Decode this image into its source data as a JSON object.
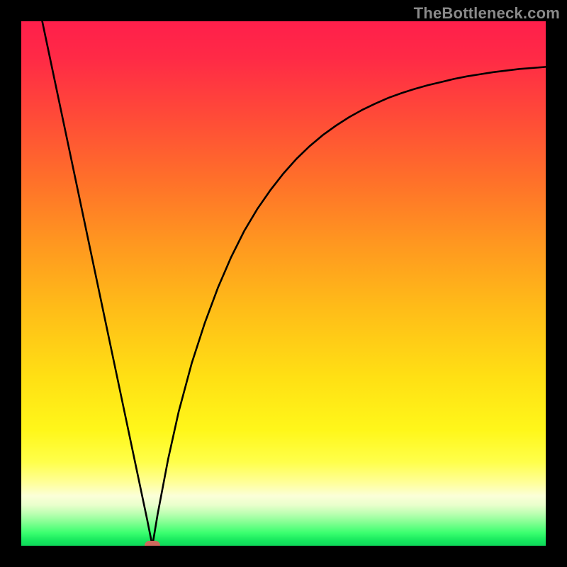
{
  "watermark": "TheBottleneck.com",
  "colors": {
    "frame": "#000000",
    "marker": "#cf6a5e",
    "gradient_stops": [
      {
        "offset": 0.0,
        "color": "#ff1f4b"
      },
      {
        "offset": 0.07,
        "color": "#ff2a46"
      },
      {
        "offset": 0.18,
        "color": "#ff4a38"
      },
      {
        "offset": 0.3,
        "color": "#ff6f2a"
      },
      {
        "offset": 0.42,
        "color": "#ff9620"
      },
      {
        "offset": 0.55,
        "color": "#ffbd18"
      },
      {
        "offset": 0.68,
        "color": "#ffe014"
      },
      {
        "offset": 0.78,
        "color": "#fff71a"
      },
      {
        "offset": 0.84,
        "color": "#ffff4a"
      },
      {
        "offset": 0.88,
        "color": "#ffff9a"
      },
      {
        "offset": 0.905,
        "color": "#fbffd8"
      },
      {
        "offset": 0.922,
        "color": "#eaffcc"
      },
      {
        "offset": 0.94,
        "color": "#b8ffb0"
      },
      {
        "offset": 0.958,
        "color": "#7bff8e"
      },
      {
        "offset": 0.975,
        "color": "#3cff70"
      },
      {
        "offset": 0.99,
        "color": "#16e85e"
      },
      {
        "offset": 1.0,
        "color": "#0fd85a"
      }
    ]
  },
  "chart_data": {
    "type": "line",
    "title": "",
    "xlabel": "",
    "ylabel": "",
    "xlim": [
      0,
      100
    ],
    "ylim": [
      0,
      100
    ],
    "optimum_x": 25,
    "marker": {
      "x": 25,
      "y": 0
    },
    "series": [
      {
        "name": "bottleneck-curve",
        "x": [
          4.0,
          6.0,
          8.0,
          10.0,
          12.0,
          14.0,
          16.0,
          18.0,
          20.0,
          22.0,
          24.0,
          25.0,
          26.0,
          28.0,
          30.0,
          32.5,
          35.0,
          37.5,
          40.0,
          42.5,
          45.0,
          47.5,
          50.0,
          52.5,
          55.0,
          57.5,
          60.0,
          62.5,
          65.0,
          67.5,
          70.0,
          72.5,
          75.0,
          77.5,
          80.0,
          82.5,
          85.0,
          87.5,
          90.0,
          92.5,
          95.0,
          97.5,
          100.0
        ],
        "y": [
          100.0,
          90.5,
          81.0,
          71.5,
          62.0,
          52.5,
          43.0,
          33.5,
          24.0,
          14.5,
          5.0,
          0.0,
          6.0,
          16.5,
          25.5,
          34.8,
          42.5,
          49.2,
          55.0,
          60.0,
          64.2,
          67.8,
          71.0,
          73.8,
          76.2,
          78.3,
          80.1,
          81.7,
          83.1,
          84.3,
          85.4,
          86.3,
          87.1,
          87.8,
          88.4,
          89.0,
          89.5,
          89.9,
          90.3,
          90.6,
          90.9,
          91.1,
          91.3
        ]
      }
    ]
  }
}
